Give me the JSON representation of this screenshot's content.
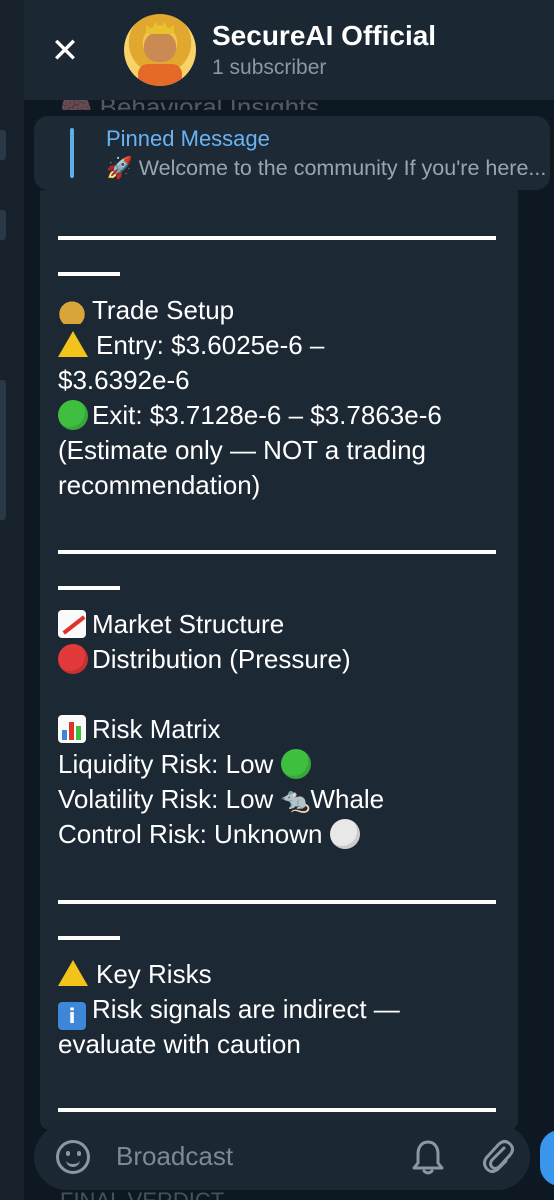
{
  "header": {
    "title": "SecureAI Official",
    "subscribers": "1 subscriber"
  },
  "previous_message_peek": "🧠 Behavioral Insights",
  "pinned": {
    "title": "Pinned Message",
    "text": "🚀 Welcome to the community  If you're here..."
  },
  "message": {
    "trade_setup": {
      "heading": "Trade Setup",
      "entry_label": "Entry: $3.6025e-6 –",
      "entry_cont": "$3.6392e-6",
      "exit_label": "Exit: $3.7128e-6 – $3.7863e-6",
      "note1": "(Estimate only — NOT a trading",
      "note2": "recommendation)"
    },
    "market_structure": {
      "heading": "Market Structure",
      "status": "Distribution (Pressure)"
    },
    "risk_matrix": {
      "heading": "Risk Matrix",
      "liquidity": "Liquidity Risk:     Low",
      "volatility": "Volatility Risk:    Low",
      "volatility_suffix": "Whale",
      "control": "Control Risk: Unknown"
    },
    "key_risks": {
      "heading": "Key Risks",
      "line1": "Risk signals are indirect —",
      "line2": "evaluate with caution"
    }
  },
  "footer": {
    "input_placeholder": "Broadcast",
    "bottom_peek": "FINAL VERDICT"
  },
  "colors": {
    "accent": "#6ab3f3",
    "bubble": "#1c2834",
    "header": "#1b2733"
  }
}
